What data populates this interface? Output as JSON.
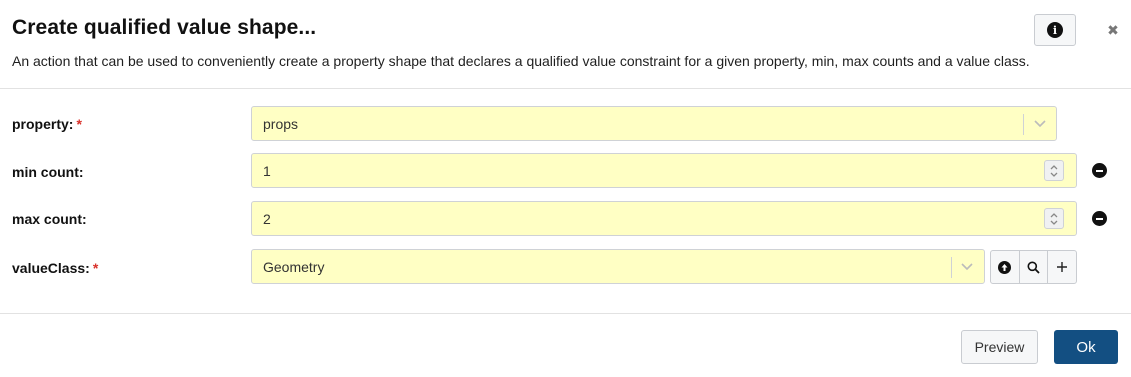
{
  "dialog": {
    "title": "Create qualified value shape...",
    "description": "An action that can be used to conveniently create a property shape that declares a qualified value constraint for a given property, min, max counts and a value class."
  },
  "form": {
    "property": {
      "label": "property:",
      "required_mark": "*",
      "value": "props"
    },
    "min_count": {
      "label": "min count:",
      "value": "1"
    },
    "max_count": {
      "label": "max count:",
      "value": "2"
    },
    "value_class": {
      "label": "valueClass:",
      "required_mark": "*",
      "value": "Geometry"
    }
  },
  "icons": {
    "info": "info-icon",
    "close": "close-icon",
    "chevron": "chevron-down-icon",
    "spinner": "spinner-arrows-icon",
    "remove": "minus-circle-icon",
    "navigate": "arrow-up-circle-icon",
    "search": "search-icon",
    "add": "plus-icon"
  },
  "footer": {
    "preview_label": "Preview",
    "ok_label": "Ok"
  },
  "colors": {
    "field_bg": "#ffffc4",
    "primary": "#134f82",
    "required": "#d9322b"
  }
}
